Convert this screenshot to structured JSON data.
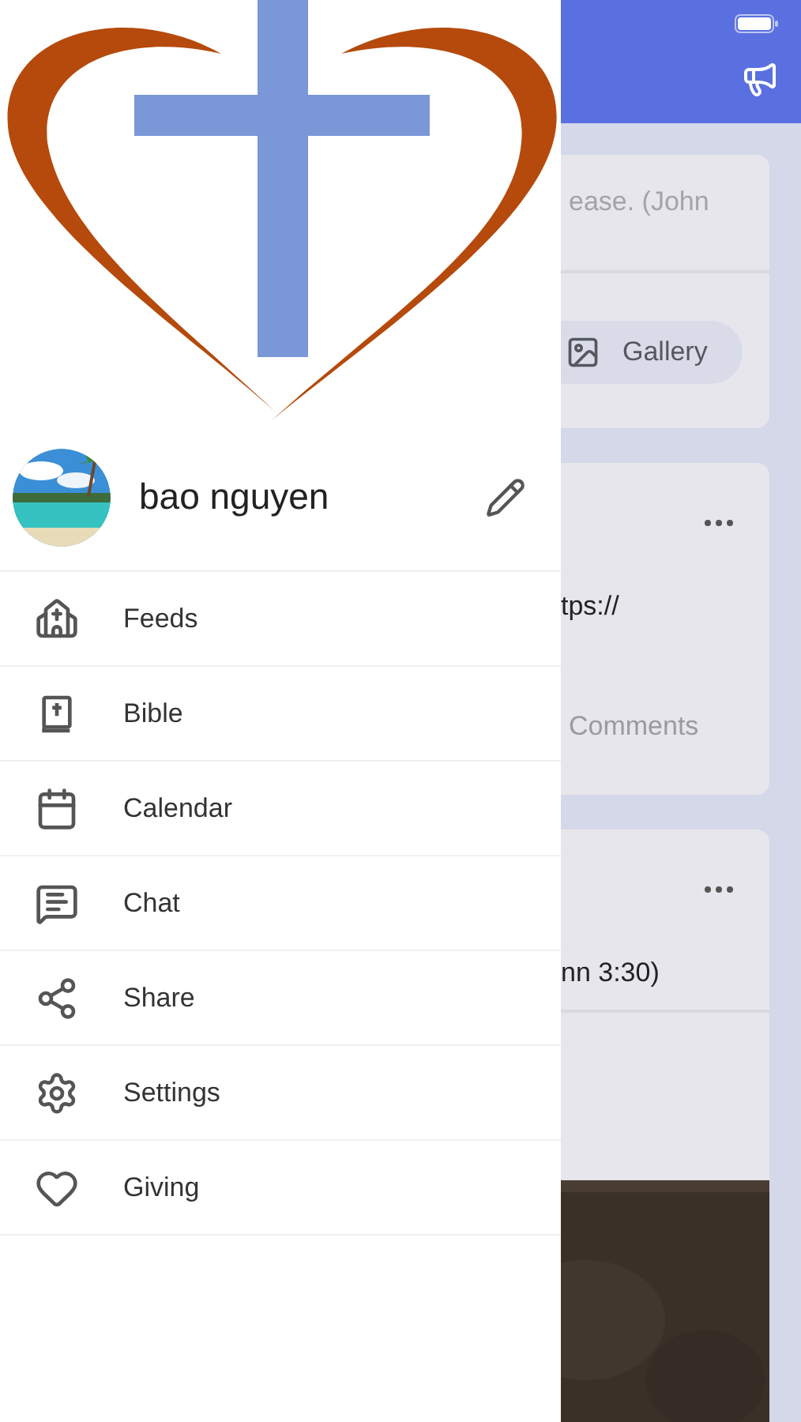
{
  "feed": {
    "composer": {
      "placeholder": "ease. (John",
      "gallery_button": "Gallery"
    },
    "posts": [
      {
        "kind": "link",
        "text": "tps://",
        "footer": "Comments"
      },
      {
        "text": "nn 3:30)"
      }
    ]
  },
  "drawer": {
    "profile": {
      "name": "bao nguyen"
    },
    "menu": [
      {
        "label": "Feeds"
      },
      {
        "label": "Bible"
      },
      {
        "label": "Calendar"
      },
      {
        "label": "Chat"
      },
      {
        "label": "Share"
      },
      {
        "label": "Settings"
      },
      {
        "label": "Giving"
      }
    ]
  }
}
